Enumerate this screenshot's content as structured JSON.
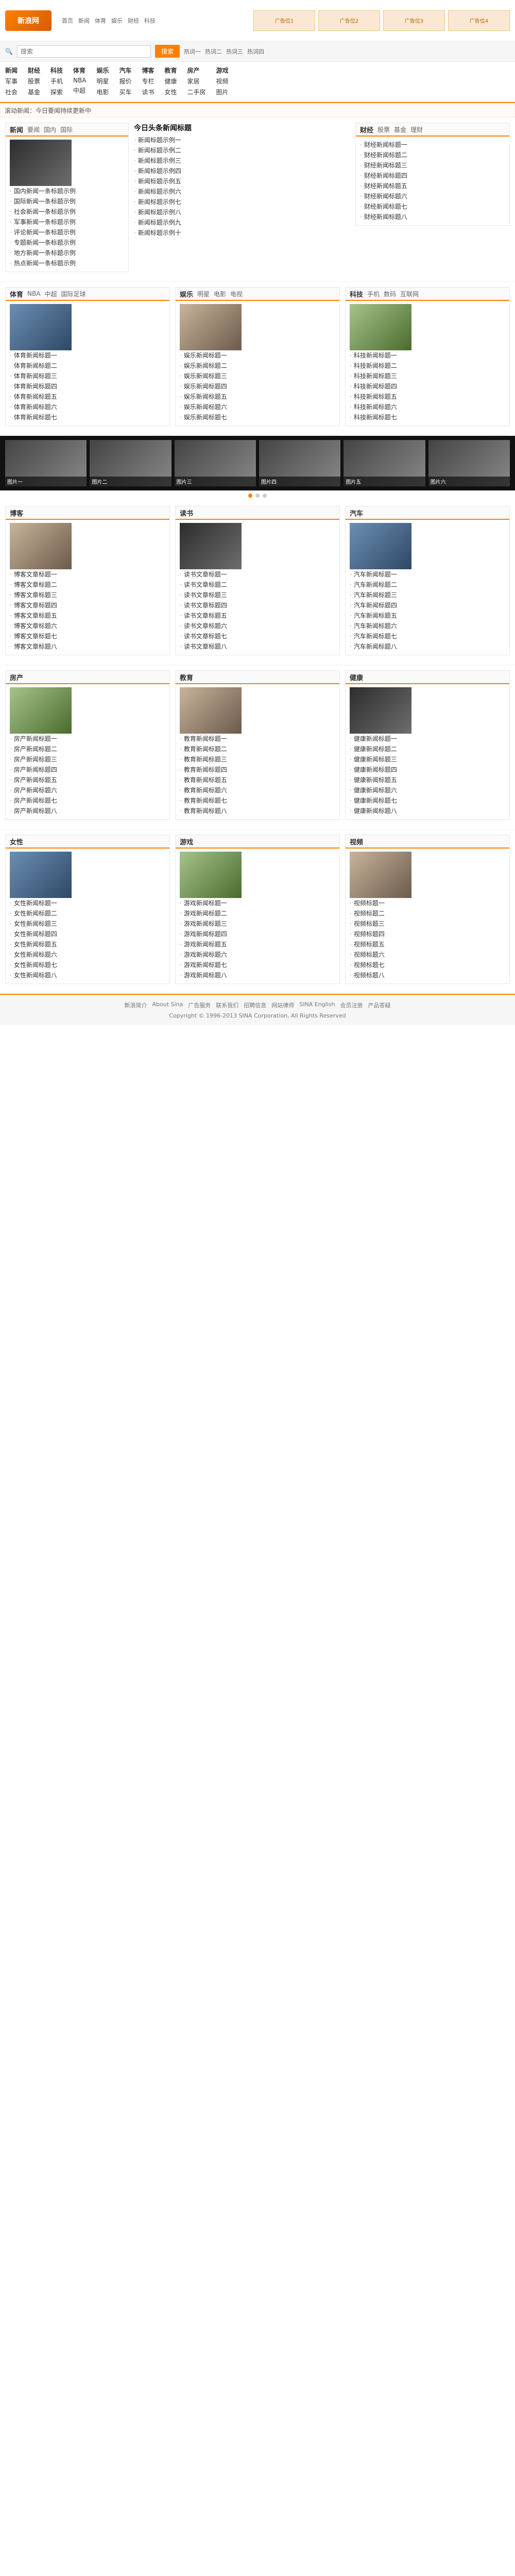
{
  "top": {
    "logo": "新浪网",
    "nav": [
      "首页",
      "新闻",
      "体育",
      "娱乐",
      "财经",
      "科技"
    ],
    "ads": [
      "广告位1",
      "广告位2",
      "广告位3",
      "广告位4"
    ]
  },
  "search": {
    "placeholder": "搜索",
    "value": "",
    "button": "搜索",
    "hot": [
      "热词一",
      "热词二",
      "热词三",
      "热词四"
    ]
  },
  "channels": [
    [
      "新闻",
      "军事",
      "社会"
    ],
    [
      "财经",
      "股票",
      "基金"
    ],
    [
      "科技",
      "手机",
      "探索"
    ],
    [
      "体育",
      "NBA",
      "中超"
    ],
    [
      "娱乐",
      "明星",
      "电影"
    ],
    [
      "汽车",
      "报价",
      "买车"
    ],
    [
      "博客",
      "专栏",
      "读书"
    ],
    [
      "教育",
      "健康",
      "女性"
    ],
    [
      "房产",
      "家居",
      "二手房"
    ],
    [
      "游戏",
      "视频",
      "图片"
    ]
  ],
  "ticker": "滚动新闻：今日要闻持续更新中",
  "main": {
    "left": {
      "title": "新闻",
      "tabs": [
        "要闻",
        "国内",
        "国际"
      ],
      "items": [
        "国内新闻一条标题示例",
        "国际新闻一条标题示例",
        "社会新闻一条标题示例",
        "军事新闻一条标题示例",
        "评论新闻一条标题示例",
        "专题新闻一条标题示例",
        "地方新闻一条标题示例",
        "热点新闻一条标题示例"
      ]
    },
    "center": {
      "headline": "今日头条新闻标题",
      "items": [
        "新闻标题示例一",
        "新闻标题示例二",
        "新闻标题示例三",
        "新闻标题示例四",
        "新闻标题示例五",
        "新闻标题示例六",
        "新闻标题示例七",
        "新闻标题示例八",
        "新闻标题示例九",
        "新闻标题示例十"
      ]
    },
    "right": {
      "title": "财经",
      "tabs": [
        "股票",
        "基金",
        "理财"
      ],
      "items": [
        "财经新闻标题一",
        "财经新闻标题二",
        "财经新闻标题三",
        "财经新闻标题四",
        "财经新闻标题五",
        "财经新闻标题六",
        "财经新闻标题七",
        "财经新闻标题八"
      ]
    }
  },
  "sports": {
    "title": "体育",
    "tabs": [
      "NBA",
      "中超",
      "国际足球"
    ],
    "items": [
      "体育新闻标题一",
      "体育新闻标题二",
      "体育新闻标题三",
      "体育新闻标题四",
      "体育新闻标题五",
      "体育新闻标题六",
      "体育新闻标题七"
    ]
  },
  "ent": {
    "title": "娱乐",
    "tabs": [
      "明星",
      "电影",
      "电视"
    ],
    "items": [
      "娱乐新闻标题一",
      "娱乐新闻标题二",
      "娱乐新闻标题三",
      "娱乐新闻标题四",
      "娱乐新闻标题五",
      "娱乐新闻标题六",
      "娱乐新闻标题七"
    ]
  },
  "tech": {
    "title": "科技",
    "tabs": [
      "手机",
      "数码",
      "互联网"
    ],
    "items": [
      "科技新闻标题一",
      "科技新闻标题二",
      "科技新闻标题三",
      "科技新闻标题四",
      "科技新闻标题五",
      "科技新闻标题六",
      "科技新闻标题七"
    ]
  },
  "film": [
    "图片一",
    "图片二",
    "图片三",
    "图片四",
    "图片五",
    "图片六"
  ],
  "blocks": [
    {
      "title": "博客",
      "items": [
        "博客文章标题一",
        "博客文章标题二",
        "博客文章标题三",
        "博客文章标题四",
        "博客文章标题五",
        "博客文章标题六",
        "博客文章标题七",
        "博客文章标题八"
      ]
    },
    {
      "title": "读书",
      "items": [
        "读书文章标题一",
        "读书文章标题二",
        "读书文章标题三",
        "读书文章标题四",
        "读书文章标题五",
        "读书文章标题六",
        "读书文章标题七",
        "读书文章标题八"
      ]
    },
    {
      "title": "汽车",
      "items": [
        "汽车新闻标题一",
        "汽车新闻标题二",
        "汽车新闻标题三",
        "汽车新闻标题四",
        "汽车新闻标题五",
        "汽车新闻标题六",
        "汽车新闻标题七",
        "汽车新闻标题八"
      ]
    },
    {
      "title": "房产",
      "items": [
        "房产新闻标题一",
        "房产新闻标题二",
        "房产新闻标题三",
        "房产新闻标题四",
        "房产新闻标题五",
        "房产新闻标题六",
        "房产新闻标题七",
        "房产新闻标题八"
      ]
    },
    {
      "title": "教育",
      "items": [
        "教育新闻标题一",
        "教育新闻标题二",
        "教育新闻标题三",
        "教育新闻标题四",
        "教育新闻标题五",
        "教育新闻标题六",
        "教育新闻标题七",
        "教育新闻标题八"
      ]
    },
    {
      "title": "健康",
      "items": [
        "健康新闻标题一",
        "健康新闻标题二",
        "健康新闻标题三",
        "健康新闻标题四",
        "健康新闻标题五",
        "健康新闻标题六",
        "健康新闻标题七",
        "健康新闻标题八"
      ]
    },
    {
      "title": "女性",
      "items": [
        "女性新闻标题一",
        "女性新闻标题二",
        "女性新闻标题三",
        "女性新闻标题四",
        "女性新闻标题五",
        "女性新闻标题六",
        "女性新闻标题七",
        "女性新闻标题八"
      ]
    },
    {
      "title": "游戏",
      "items": [
        "游戏新闻标题一",
        "游戏新闻标题二",
        "游戏新闻标题三",
        "游戏新闻标题四",
        "游戏新闻标题五",
        "游戏新闻标题六",
        "游戏新闻标题七",
        "游戏新闻标题八"
      ]
    },
    {
      "title": "视频",
      "items": [
        "视频标题一",
        "视频标题二",
        "视频标题三",
        "视频标题四",
        "视频标题五",
        "视频标题六",
        "视频标题七",
        "视频标题八"
      ]
    }
  ],
  "footer": {
    "links": [
      "新浪简介",
      "About Sina",
      "广告服务",
      "联系我们",
      "招聘信息",
      "网站律师",
      "SINA English",
      "会员注册",
      "产品答疑"
    ],
    "copy": "Copyright © 1996-2013 SINA Corporation, All Rights Reserved"
  }
}
